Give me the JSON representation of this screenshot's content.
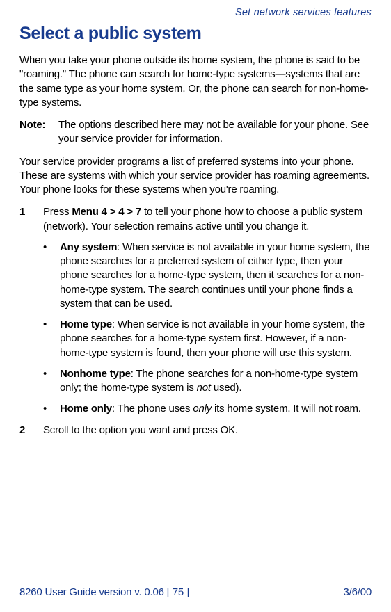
{
  "header": {
    "category": "Set network services features"
  },
  "title": "Select a public system",
  "intro": "When you take your phone outside its home system, the phone is said to be \"roaming.\" The phone can search for home-type systems—systems that are the same type as your home system. Or, the phone can search for non-home-type systems.",
  "note": {
    "label": "Note:",
    "text": "The options described here may not be available for your phone. See your service provider for information."
  },
  "provider": "Your service provider programs a list of preferred systems into your phone. These are systems with which your service provider has roaming agreements. Your phone looks for these systems when you're roaming.",
  "steps": {
    "s1": {
      "num": "1",
      "pre": "Press ",
      "bold": "Menu 4 > 4 > 7",
      "post": " to tell your phone how to choose a public system (network). Your selection remains active until you change it."
    },
    "s2": {
      "num": "2",
      "text": "Scroll to the option you want and press OK."
    }
  },
  "bullets": {
    "b1": {
      "label": "Any system",
      "text": ": When service is not available in your home system, the phone searches for a preferred system of either type, then your phone searches for a home-type system, then it searches for a non-home-type system. The search continues until your phone finds a system that can be used."
    },
    "b2": {
      "label": "Home type",
      "text": ": When service is not available in your home system, the phone searches for a home-type system first. However, if a non-home-type system is found, then your phone will use this system."
    },
    "b3": {
      "label": "Nonhome type",
      "pre": ": The phone searches for a non-home-type system only; the home-type system is ",
      "italic": "not",
      "post": " used)."
    },
    "b4": {
      "label": "Home only",
      "pre": ": The phone uses ",
      "italic": "only",
      "post": " its home system. It will not roam."
    }
  },
  "footer": {
    "left": "8260 User Guide version v. 0.06 [ 75 ]",
    "right": "3/6/00"
  }
}
